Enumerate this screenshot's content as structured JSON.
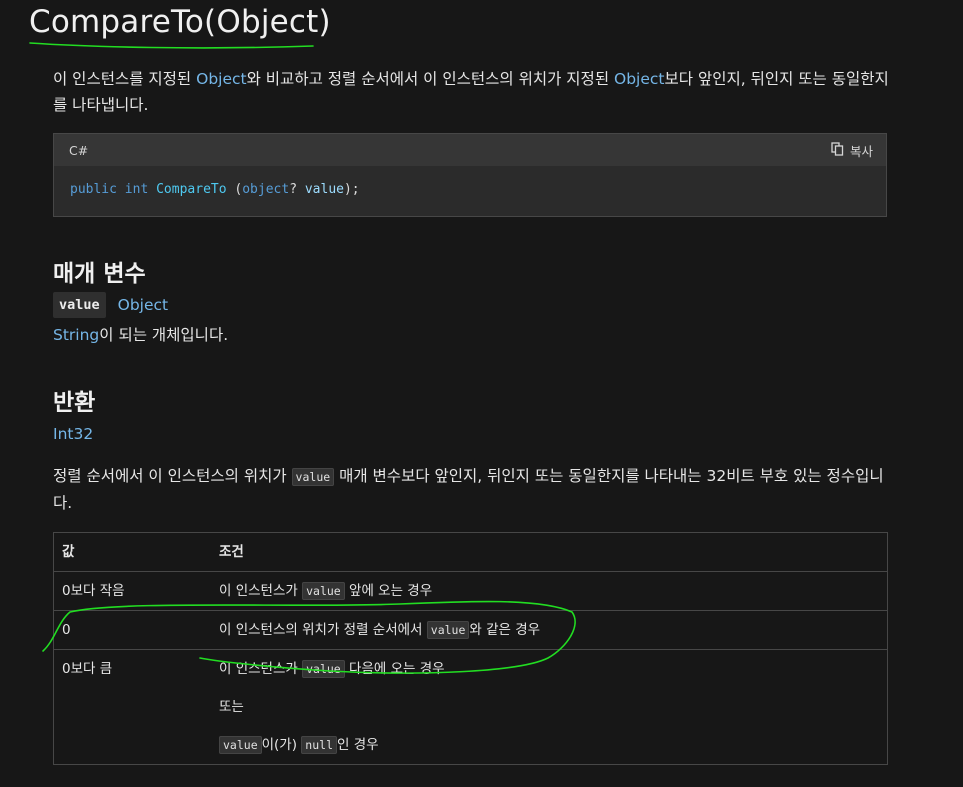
{
  "title": "CompareTo(Object)",
  "intro": {
    "p1": "이 인스턴스를 지정된 ",
    "link1": "Object",
    "p2": "와 비교하고 정렬 순서에서 이 인스턴스의 위치가 지정된 ",
    "link2": "Object",
    "p3": "보다 앞인지, 뒤인지 또는 동일한지를 나타냅니다."
  },
  "code": {
    "language": "C#",
    "copy_label": "복사",
    "kw_public": "public",
    "kw_int": "int",
    "method": "CompareTo",
    "open": " (",
    "param_type": "object",
    "nullable": "? ",
    "param_name": "value",
    "close": ");"
  },
  "params": {
    "heading": "매개 변수",
    "name": "value",
    "type_link": "Object",
    "desc_link": "String",
    "desc_rest": "이 되는 개체입니다."
  },
  "returns": {
    "heading": "반환",
    "type_link": "Int32",
    "desc_p1": "정렬 순서에서 이 인스턴스의 위치가 ",
    "desc_code": "value",
    "desc_p2": " 매개 변수보다 앞인지, 뒤인지 또는 동일한지를 나타내는 32비트 부호 있는 정수입니다."
  },
  "table": {
    "headers": [
      "값",
      "조건"
    ],
    "rows": [
      {
        "value": "0보다 작음",
        "c1": "이 인스턴스가 ",
        "code": "value",
        "c2": " 앞에 오는 경우"
      },
      {
        "value": "0",
        "c1": "이 인스턴스의 위치가 정렬 순서에서 ",
        "code": "value",
        "c2": "와 같은 경우"
      },
      {
        "value": "0보다 큼",
        "c1": "이 인스턴스가 ",
        "code": "value",
        "c2": " 다음에 오는 경우",
        "or": "또는",
        "null_code1": "value",
        "null_mid": "이(가) ",
        "null_code2": "null",
        "null_end": "인 경우"
      }
    ]
  },
  "annotation_color": "#22dd22"
}
